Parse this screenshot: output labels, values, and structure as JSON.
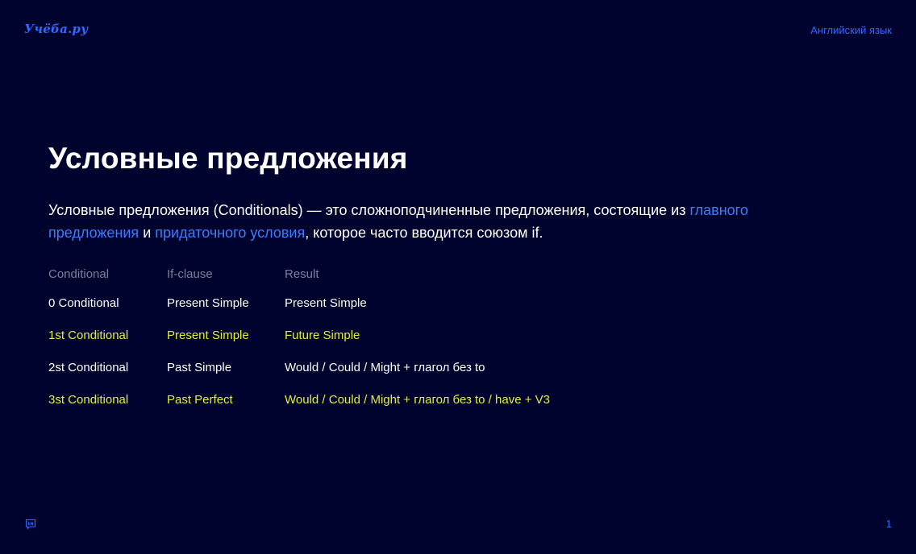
{
  "header": {
    "logo": "Учёба.ру",
    "subject": "Английский язык"
  },
  "slide": {
    "title": "Условные предложения",
    "intro": {
      "part1": "Условные предложения (Conditionals) — это сложноподчиненные предложения, состоящие из ",
      "link1": "главного предложения",
      "part2": " и ",
      "link2": "придаточного условия",
      "part3": ", которое часто вводится союзом if."
    }
  },
  "table": {
    "headers": [
      "Conditional",
      "If-clause",
      "Result"
    ],
    "rows": [
      {
        "conditional": "0 Conditional",
        "if_clause": "Present Simple",
        "result": "Present Simple"
      },
      {
        "conditional": "1st Conditional",
        "if_clause": "Present Simple",
        "result": "Future Simple"
      },
      {
        "conditional": "2st Conditional",
        "if_clause": "Past Simple",
        "result": "Would / Could / Might + глагол без to"
      },
      {
        "conditional": "3st Conditional",
        "if_clause": "Past Perfect",
        "result": "Would / Could / Might + глагол без to / have + V3"
      }
    ]
  },
  "footer": {
    "icon": "en-language-icon",
    "icon_text": "EN",
    "page_number": "1"
  },
  "colors": {
    "background": "#00032e",
    "accent_blue": "#2f6bff",
    "link_blue": "#3d7bff",
    "highlight_yellow": "#e4ee3a",
    "header_gray": "#7b7f9e",
    "text": "#ffffff"
  }
}
